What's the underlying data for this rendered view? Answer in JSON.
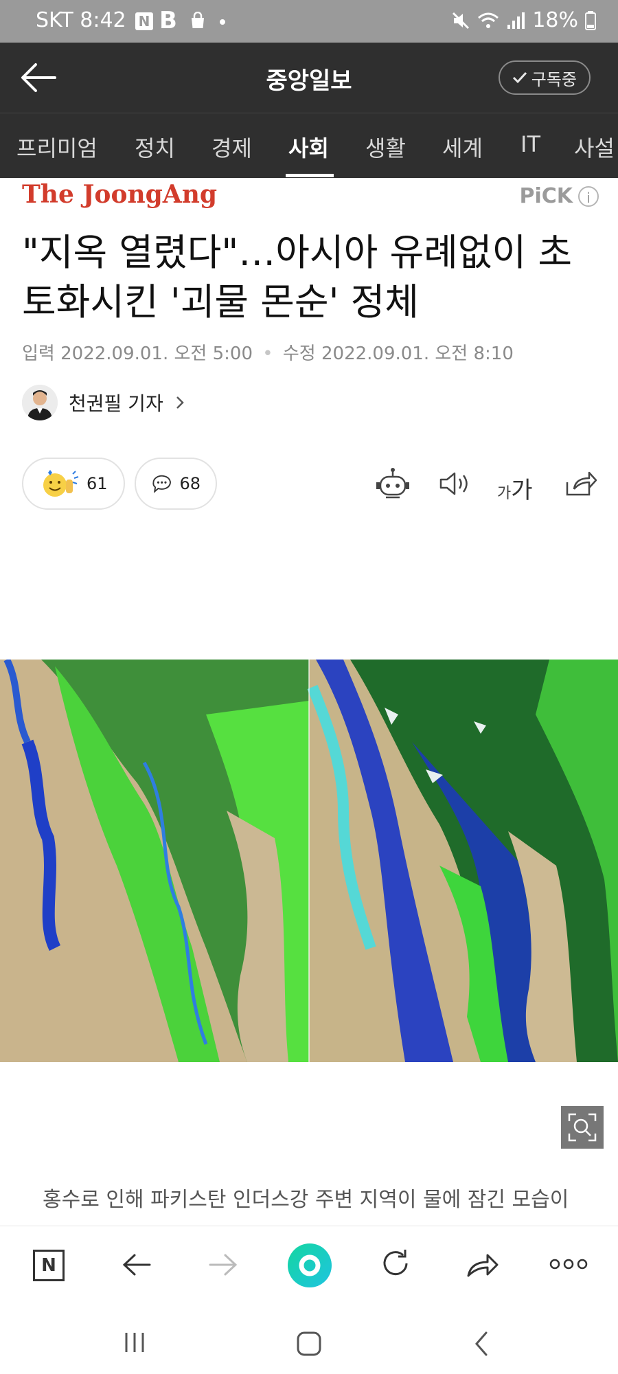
{
  "status_bar": {
    "carrier_time": "SKT 8:42",
    "n_badge": "N",
    "b_badge": "B",
    "battery": "18%"
  },
  "header": {
    "title": "중앙일보",
    "subscribe_label": "구독중"
  },
  "tabs": [
    "프리미엄",
    "정치",
    "경제",
    "사회",
    "생활",
    "세계",
    "IT",
    "사설"
  ],
  "active_tab": "사회",
  "article": {
    "brand_logo": "The JoongAng",
    "pick_label": "PiCK",
    "pick_info": "i",
    "headline": "\"지옥 열렸다\"…아시아 유례없이 초토화시킨 '괴물 몬순' 정체",
    "published_label": "입력",
    "published": "2022.09.01. 오전 5:00",
    "modified_label": "수정",
    "modified": "2022.09.01. 오전 8:10",
    "reporter": "천권필 기자",
    "reaction_count": "61",
    "comment_count": "68",
    "font_size_label_small": "가",
    "font_size_label_large": "가",
    "caption": "홍수로 인해 파키스탄 인더스강 주변 지역이 물에 잠긴 모습이"
  },
  "bottom_nav": {
    "home_badge": "N"
  },
  "colors": {
    "header_bg": "#2f2f2f",
    "brand_red": "#d23c2c",
    "accent_green": "#19d08a"
  }
}
